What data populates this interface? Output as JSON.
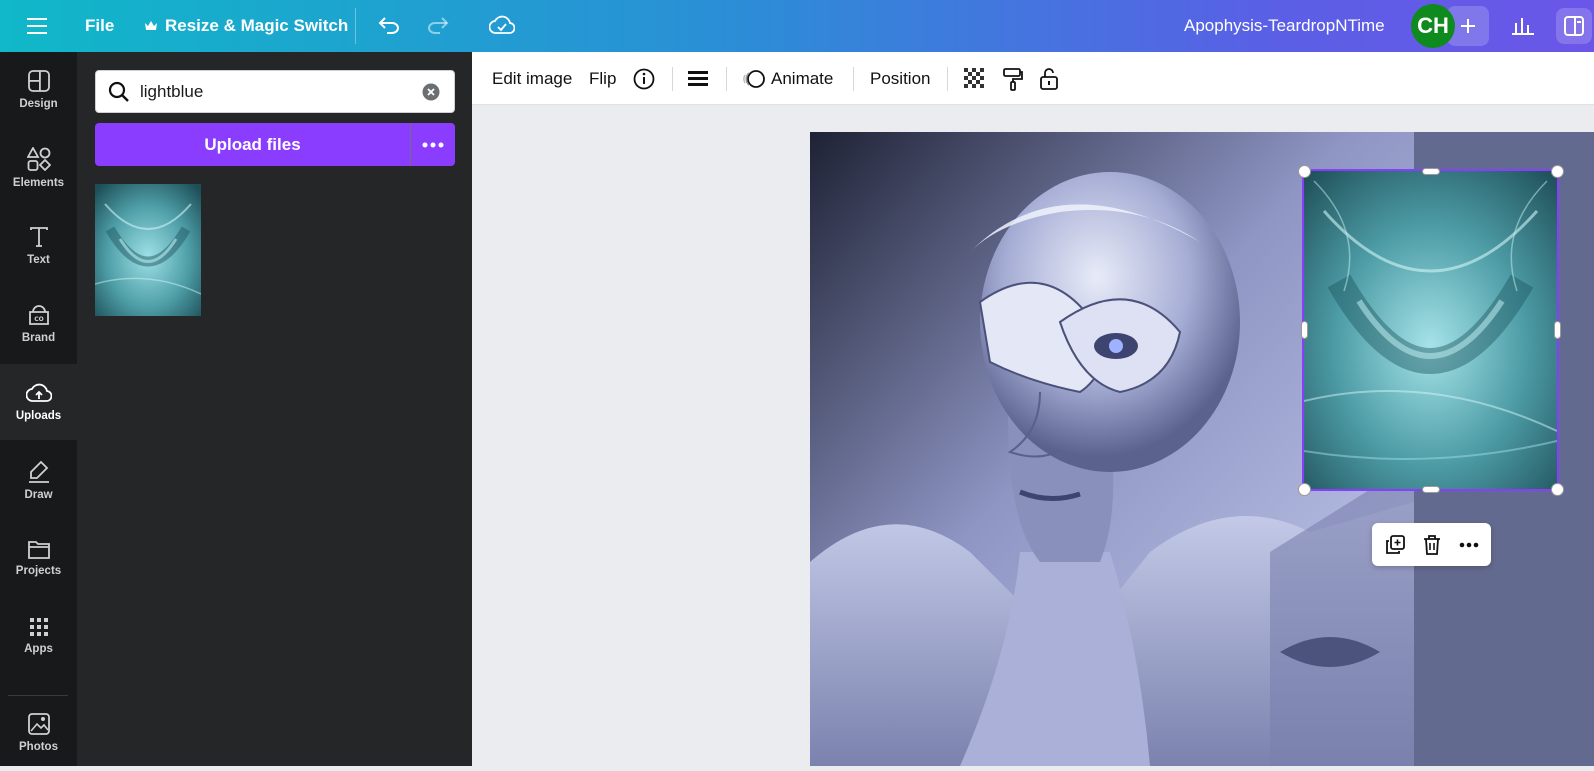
{
  "topbar": {
    "file_label": "File",
    "resize_label": "Resize & Magic Switch",
    "doc_title": "Apophysis-TeardropNTime",
    "avatar_initials": "CH"
  },
  "rail": {
    "items": [
      {
        "label": "Design",
        "icon": "design-icon"
      },
      {
        "label": "Elements",
        "icon": "elements-icon"
      },
      {
        "label": "Text",
        "icon": "text-icon"
      },
      {
        "label": "Brand",
        "icon": "brand-icon"
      },
      {
        "label": "Uploads",
        "icon": "uploads-icon",
        "active": true
      },
      {
        "label": "Draw",
        "icon": "draw-icon"
      },
      {
        "label": "Projects",
        "icon": "projects-icon"
      },
      {
        "label": "Apps",
        "icon": "apps-icon"
      },
      {
        "label": "Photos",
        "icon": "photos-icon"
      }
    ]
  },
  "panel": {
    "search_value": "lightblue",
    "upload_label": "Upload files"
  },
  "toolbar": {
    "edit_image": "Edit image",
    "flip": "Flip",
    "animate": "Animate",
    "position": "Position"
  },
  "colors": {
    "accent": "#8b3dff",
    "rail_bg": "#18191b",
    "panel_bg": "#252627",
    "avatar": "#0f8a1f"
  }
}
